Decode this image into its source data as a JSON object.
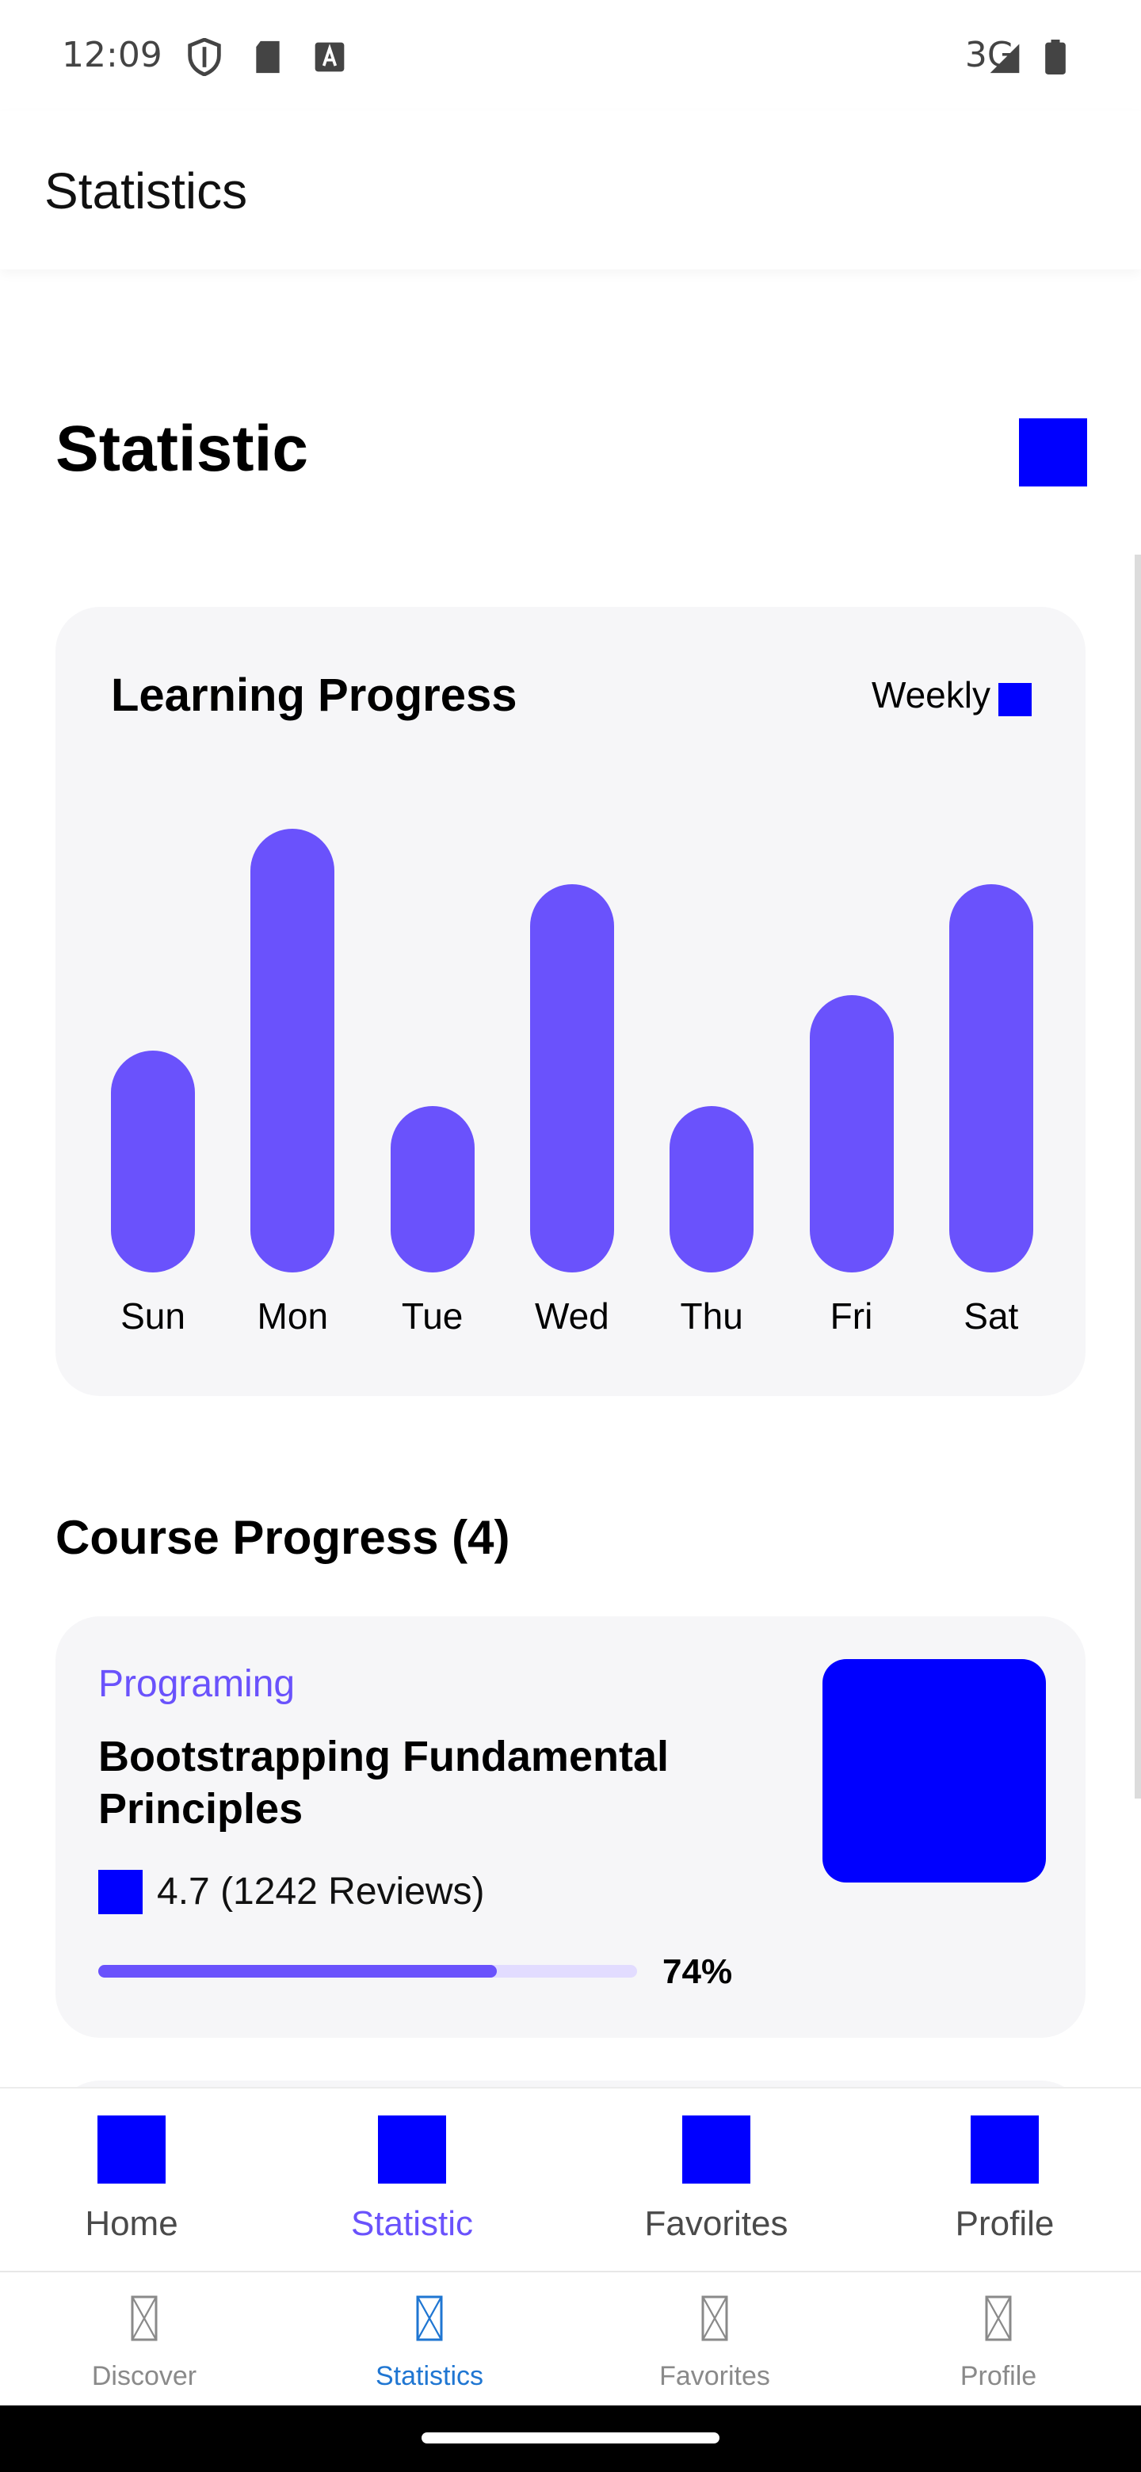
{
  "status_bar": {
    "time": "12:09",
    "network": "3G",
    "icons": [
      "shield-icon",
      "sd-card-icon",
      "font-icon",
      "signal-icon",
      "battery-icon"
    ]
  },
  "appbar": {
    "title": "Statistics"
  },
  "page": {
    "heading": "Statistic",
    "heading_icon": "placeholder-icon"
  },
  "learning_progress": {
    "title": "Learning Progress",
    "period": "Weekly",
    "period_icon": "dropdown-icon",
    "chart_data": {
      "type": "bar",
      "categories": [
        "Sun",
        "Mon",
        "Tue",
        "Wed",
        "Thu",
        "Fri",
        "Sat"
      ],
      "values": [
        0.5,
        1.0,
        0.375,
        0.875,
        0.375,
        0.625,
        0.875
      ],
      "color": "#6a52fc"
    }
  },
  "course_progress": {
    "heading": "Course Progress (4)",
    "courses": [
      {
        "category": "Programing",
        "title": "Bootstrapping Fundamental Principles",
        "rating_icon": "star-icon",
        "rating": "4.7 (1242 Reviews)",
        "progress": 0.74,
        "progress_label": "74%"
      }
    ]
  },
  "inner_nav": {
    "items": [
      {
        "label": "Home",
        "icon": "home-icon"
      },
      {
        "label": "Statistic",
        "icon": "statistic-icon",
        "active": true
      },
      {
        "label": "Favorites",
        "icon": "favorites-icon"
      },
      {
        "label": "Profile",
        "icon": "profile-icon"
      }
    ]
  },
  "outer_nav": {
    "items": [
      {
        "label": "Discover",
        "icon": "discover-icon"
      },
      {
        "label": "Statistics",
        "icon": "statistics-icon",
        "active": true
      },
      {
        "label": "Favorites",
        "icon": "favorites-icon"
      },
      {
        "label": "Profile",
        "icon": "profile-icon"
      }
    ]
  },
  "colors": {
    "accent": "#6a52fc",
    "placeholder": "#0000ff",
    "card_bg": "#f6f6f8",
    "outer_active": "#1f76d2"
  }
}
